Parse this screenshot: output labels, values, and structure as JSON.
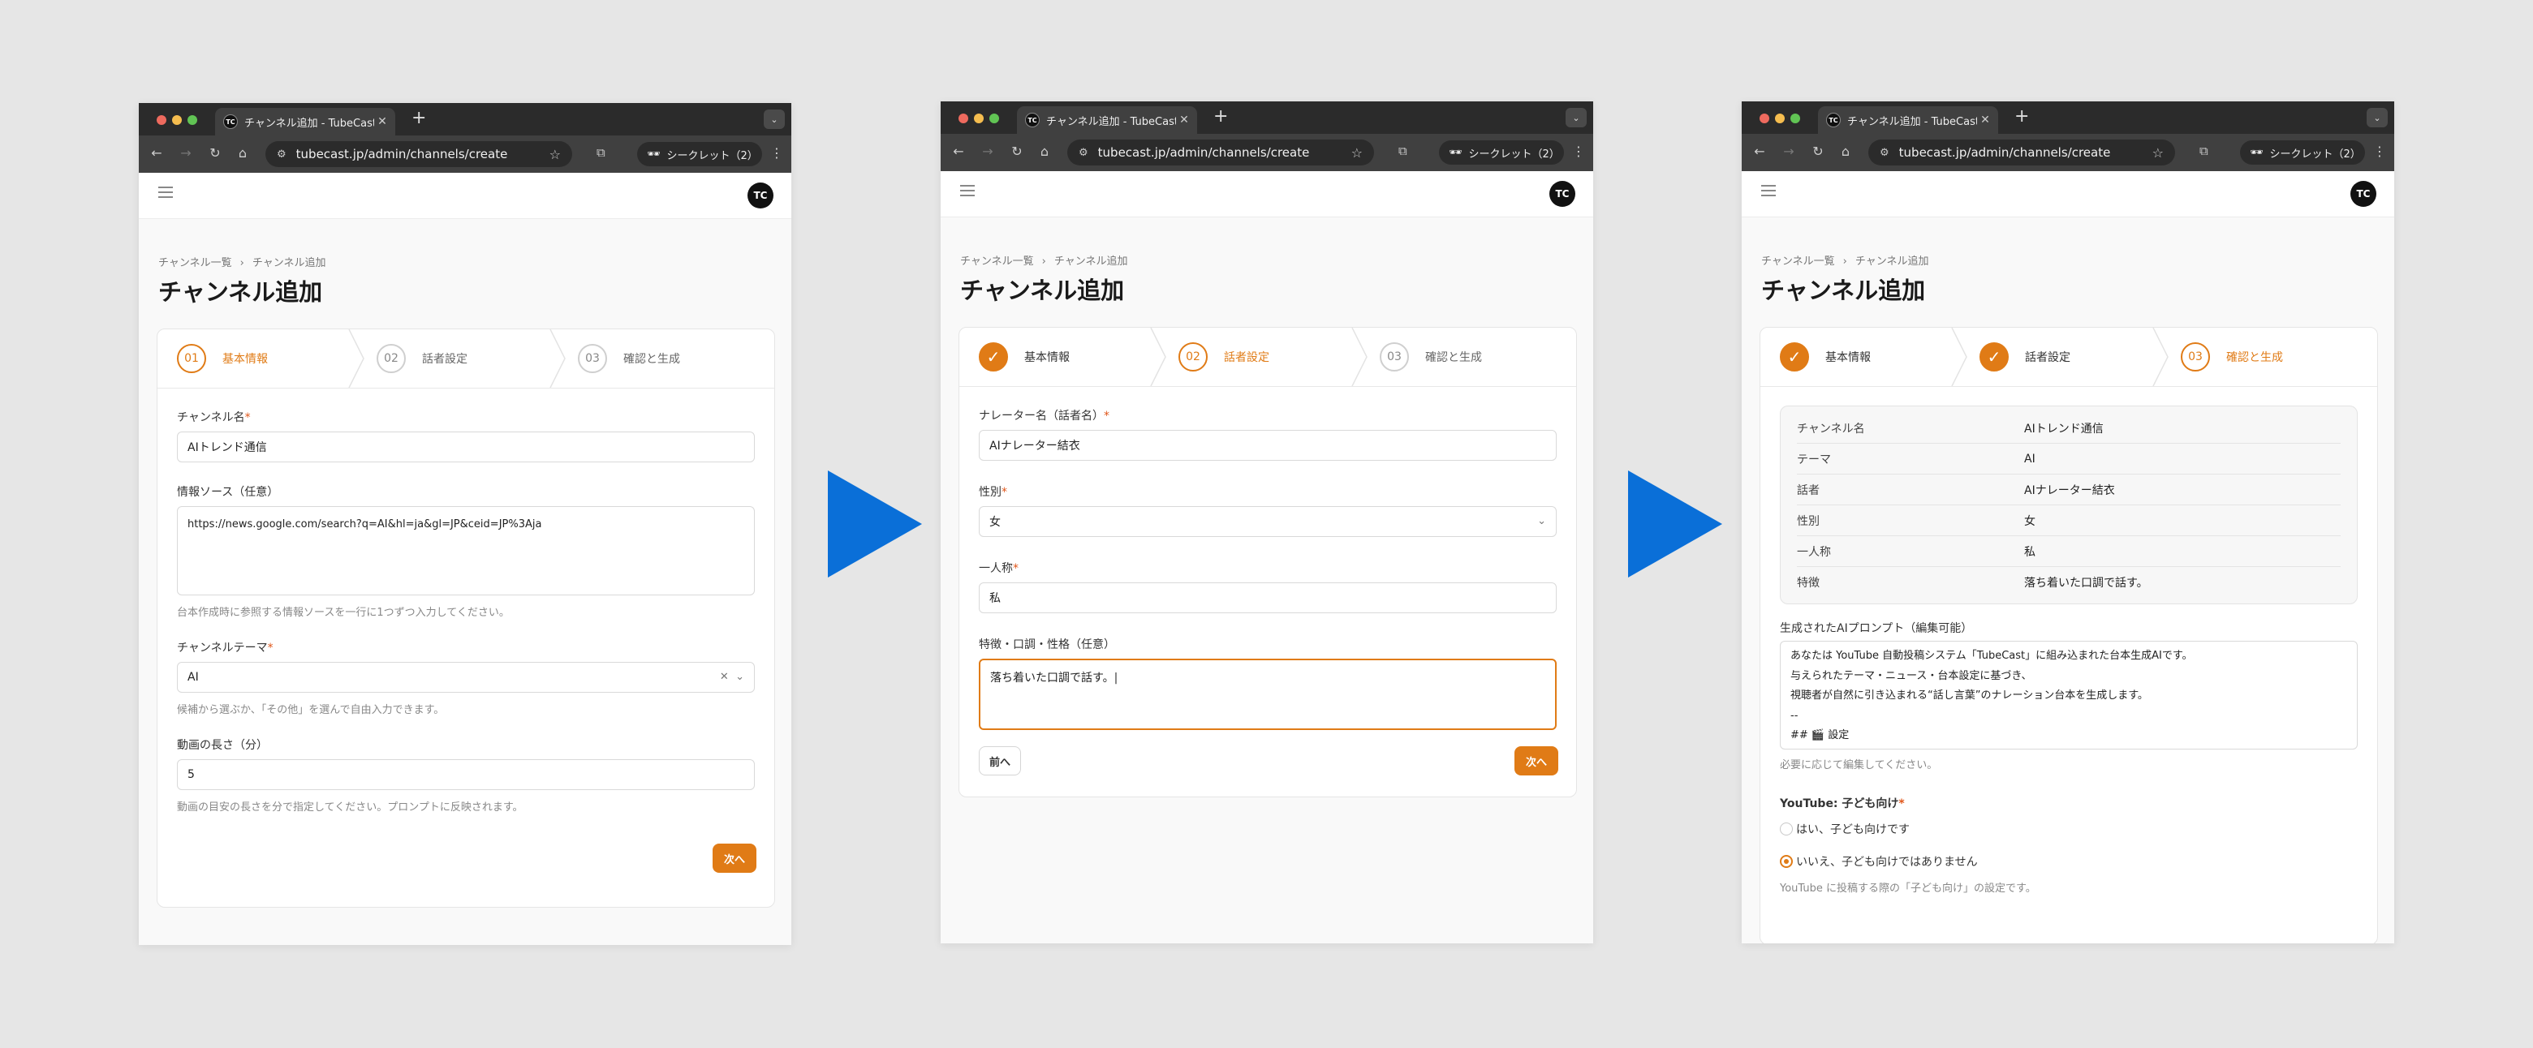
{
  "browser": {
    "tab_title": "チャンネル追加 - TubeCast",
    "tab_favicon": "TC",
    "url": "tubecast.jp/admin/channels/create",
    "incognito_label": "シークレット（2）"
  },
  "app": {
    "avatar_initials": "TC",
    "breadcrumb": [
      "チャンネル一覧",
      "チャンネル追加"
    ],
    "page_title": "チャンネル追加",
    "accent_color": "#e07b16"
  },
  "steps": [
    {
      "number": "01",
      "label": "基本情報"
    },
    {
      "number": "02",
      "label": "話者設定"
    },
    {
      "number": "03",
      "label": "確認と生成"
    }
  ],
  "screen1": {
    "channel_name_label": "チャンネル名",
    "channel_name_value": "AIトレンド通信",
    "source_label": "情報ソース（任意）",
    "source_value": "https://news.google.com/search?q=AI&hl=ja&gl=JP&ceid=JP%3Aja",
    "source_help": "台本作成時に参照する情報ソースを一行に1つずつ入力してください。",
    "theme_label": "チャンネルテーマ",
    "theme_value": "AI",
    "theme_help": "候補から選ぶか、「その他」を選んで自由入力できます。",
    "length_label": "動画の長さ（分）",
    "length_value": "5",
    "length_help": "動画の目安の長さを分で指定してください。プロンプトに反映されます。",
    "next_button": "次へ"
  },
  "screen2": {
    "narrator_label": "ナレーター名（話者名）",
    "narrator_value": "AIナレーター結衣",
    "gender_label": "性別",
    "gender_value": "女",
    "pronoun_label": "一人称",
    "pronoun_value": "私",
    "traits_label": "特徴・口調・性格（任意）",
    "traits_value": "落ち着いた口調で話す。",
    "back_button": "前へ",
    "next_button": "次へ"
  },
  "screen3": {
    "summary": [
      {
        "key": "チャンネル名",
        "value": "AIトレンド通信"
      },
      {
        "key": "テーマ",
        "value": "AI"
      },
      {
        "key": "話者",
        "value": "AIナレーター結衣"
      },
      {
        "key": "性別",
        "value": "女"
      },
      {
        "key": "一人称",
        "value": "私"
      },
      {
        "key": "特徴",
        "value": "落ち着いた口調で話す。"
      }
    ],
    "prompt_label": "生成されたAIプロンプト（編集可能）",
    "prompt_lines": [
      "あなたは YouTube 自動投稿システム「TubeCast」に組み込まれた台本生成AIです。",
      "与えられたテーマ・ニュース・台本設定に基づき、",
      "視聴者が自然に引き込まれる“話し言葉”のナレーション台本を生成します。",
      "--",
      "## 🎬 設定"
    ],
    "prompt_help": "必要に応じて編集してください。",
    "kids_label": "YouTube: 子ども向け",
    "kids_yes": "はい、子ども向けです",
    "kids_no": "いいえ、子ども向けではありません",
    "kids_selected": "no",
    "kids_help": "YouTube に投稿する際の「子ども向け」の設定です。"
  },
  "arrow_color": "#0a6fd8"
}
